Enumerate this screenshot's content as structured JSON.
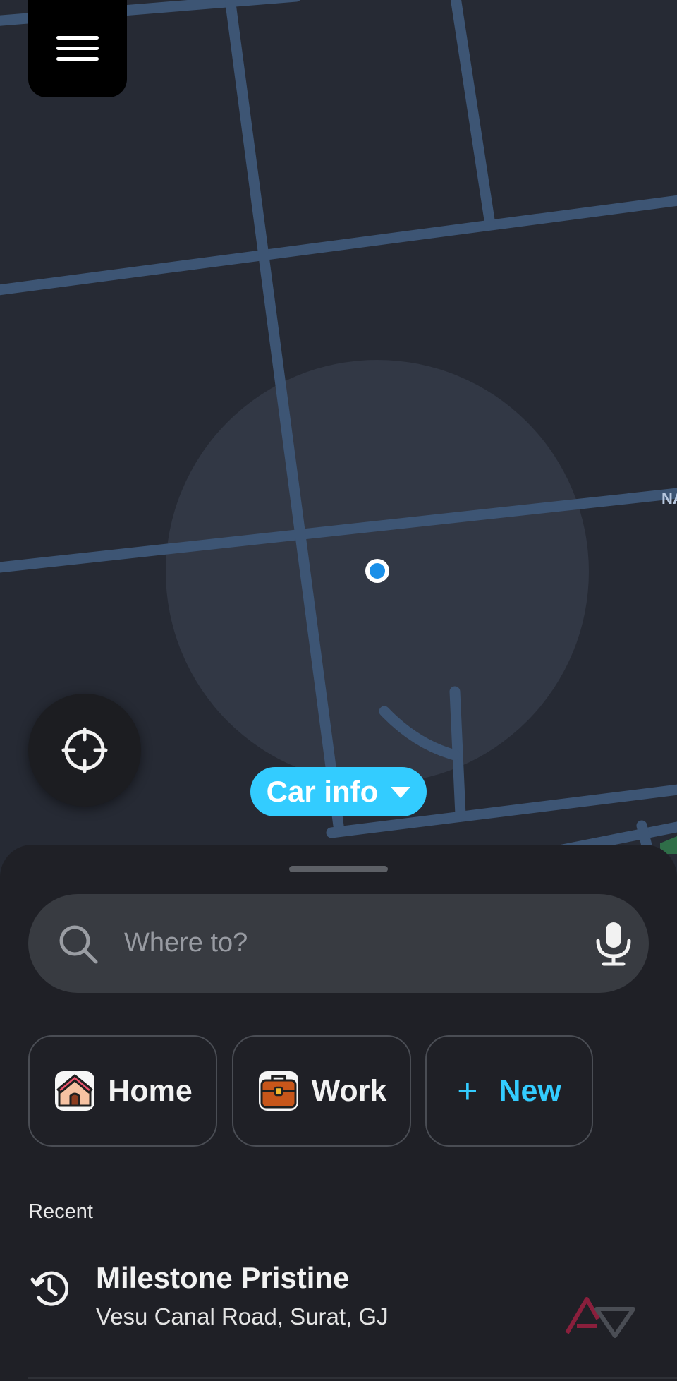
{
  "map": {
    "street_label": "NA"
  },
  "controls": {
    "menu_icon": "hamburger-menu-icon",
    "recenter_icon": "crosshair-icon",
    "car_info_label": "Car info"
  },
  "search": {
    "placeholder": "Where to?",
    "left_icon": "search-icon",
    "right_icon": "microphone-icon"
  },
  "shortcuts": {
    "home_label": "Home",
    "work_label": "Work",
    "new_label": "New",
    "new_symbol": "+"
  },
  "recent": {
    "section_label": "Recent",
    "items": [
      {
        "title": "Milestone Pristine",
        "subtitle": "Vesu Canal Road, Surat, GJ"
      }
    ]
  },
  "colors": {
    "accent": "#33ccff",
    "map_background": "#262a34",
    "road": "#3d5574",
    "sheet_background": "#1f2026",
    "location_dot": "#1a8fe8"
  }
}
